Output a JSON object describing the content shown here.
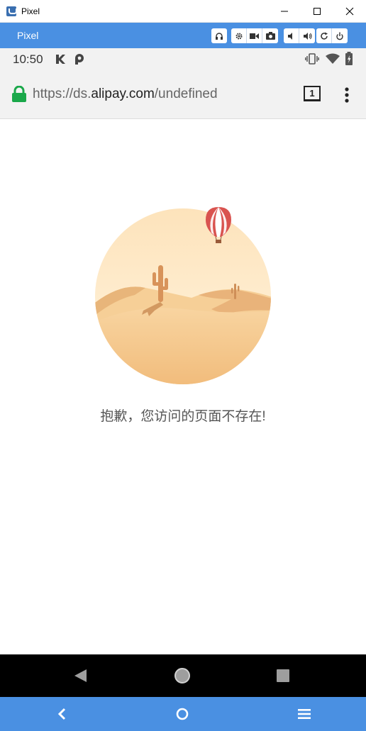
{
  "window": {
    "title": "Pixel"
  },
  "emulator": {
    "name": "Pixel",
    "toolbar_icons": [
      "headphones-icon",
      "settings-icon",
      "video-icon",
      "camera-icon",
      "volume-down-icon",
      "volume-up-icon",
      "rotate-icon",
      "power-icon"
    ]
  },
  "statusbar": {
    "time": "10:50",
    "left_icons": [
      "k-app-icon",
      "p-app-icon"
    ],
    "right_icons": [
      "vibrate-icon",
      "wifi-icon",
      "battery-icon"
    ]
  },
  "browser": {
    "url_prefix": "https://ds.",
    "url_domain": "alipay.com",
    "url_path": "/undefined",
    "tab_count": "1"
  },
  "page": {
    "error_message": "抱歉，您访问的页面不存在!"
  },
  "colors": {
    "emulator_blue": "#4a90e2",
    "lock_green": "#1aa84a",
    "sand": "#f3c387",
    "sky": "#fde7c3"
  }
}
